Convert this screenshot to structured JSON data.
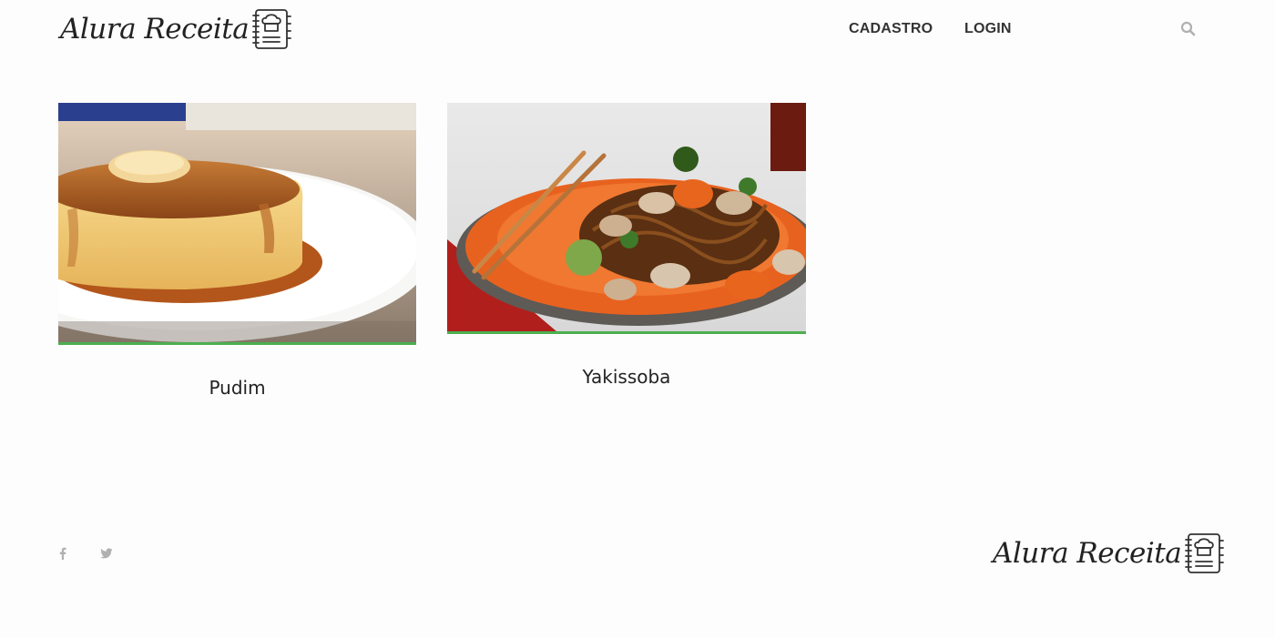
{
  "brand": {
    "name": "Alura Receita",
    "icon": "chef-recipe-book-icon"
  },
  "nav": {
    "items": [
      {
        "label": "CADASTRO"
      },
      {
        "label": "LOGIN"
      }
    ],
    "search_icon": "search-icon"
  },
  "recipes": [
    {
      "name": "Pudim",
      "image": "pudim-photo"
    },
    {
      "name": "Yakissoba",
      "image": "yakissoba-photo"
    }
  ],
  "footer": {
    "social": [
      "facebook-icon",
      "twitter-icon"
    ],
    "brand": "Alura Receita"
  },
  "colors": {
    "accent": "#4caf50",
    "text": "#333333",
    "muted": "#b0b0b0",
    "background": "#fdfdfd"
  }
}
